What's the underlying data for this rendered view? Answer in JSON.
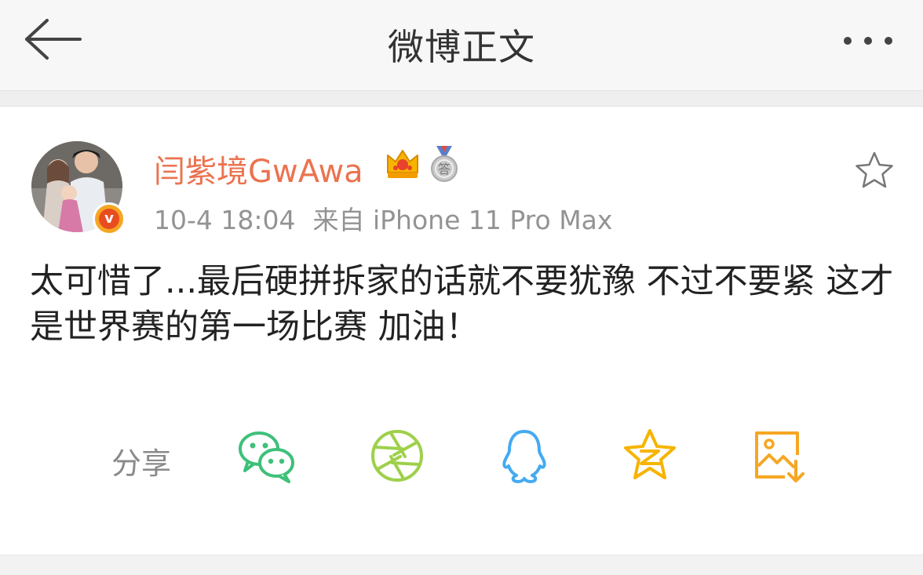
{
  "header": {
    "title": "微博正文",
    "back_icon": "arrow-left-icon",
    "more_icon": "more-dots-icon"
  },
  "post": {
    "author": {
      "name": "闫紫境GwAwa",
      "verified_badge": "v",
      "badges": [
        "crown-icon",
        "medal-icon"
      ],
      "name_color": "#eb7350"
    },
    "time": "10-4 18:04",
    "source": "来自 iPhone 11 Pro Max",
    "text": "太可惜了...最后硬拼拆家的话就不要犹豫 不过不要紧 这才是世界赛的第一场比赛 加油！",
    "favorite_icon": "star-outline-icon"
  },
  "share": {
    "label": "分享",
    "targets": [
      {
        "icon": "wechat-icon",
        "color": "#3ec07a"
      },
      {
        "icon": "moments-icon",
        "color": "#9ed04b"
      },
      {
        "icon": "qq-icon",
        "color": "#44aaf2"
      },
      {
        "icon": "qzone-icon",
        "color": "#f6b400"
      },
      {
        "icon": "save-image-icon",
        "color": "#f6a623"
      }
    ]
  }
}
